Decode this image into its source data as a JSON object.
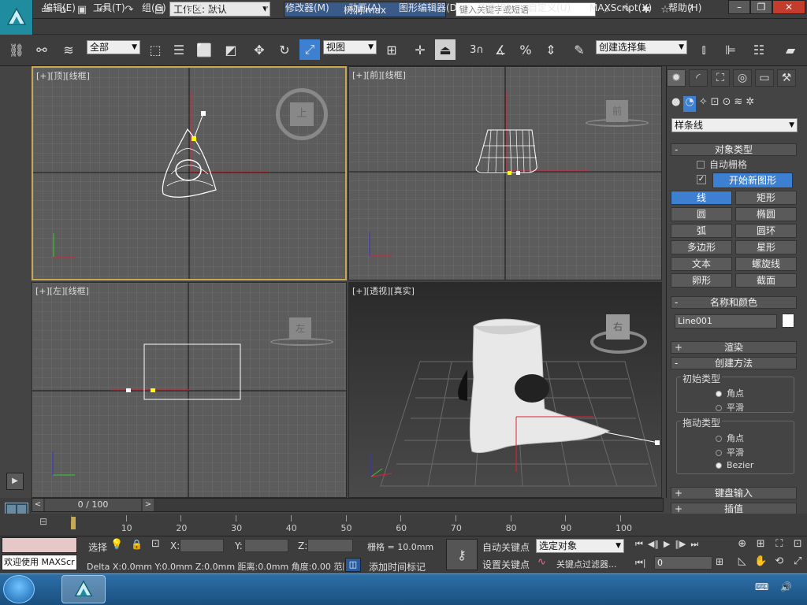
{
  "title_bar": {
    "workspace_label": "工作区: 默认",
    "filename": "树洞.max",
    "search_placeholder": "键入关键字或短语"
  },
  "menu": [
    "编辑(E)",
    "工具(T)",
    "组(G)",
    "视图(V)",
    "创建(C)",
    "修改器(M)",
    "动画(A)",
    "图形编辑器(D)",
    "渲染(R)",
    "自定义(U)",
    "MAXScript(X)",
    "帮助(H)"
  ],
  "toolbar": {
    "selection_filter": "全部",
    "reference_coord": "视图",
    "snap_label": "3",
    "named_selection": "创建选择集"
  },
  "viewports": {
    "top": {
      "label": "[+][顶][线框]",
      "cube_label": "上"
    },
    "front": {
      "label": "[+][前][线框]",
      "cube_label": "前"
    },
    "left": {
      "label": "[+][左][线框]",
      "cube_label": "左"
    },
    "perspective": {
      "label": "[+][透视][真实]",
      "cube_label": "右"
    }
  },
  "command_panel": {
    "category": "样条线",
    "object_type_title": "对象类型",
    "auto_grid": "自动栅格",
    "start_new_shape": "开始新图形",
    "objects": [
      "线",
      "矩形",
      "圆",
      "椭圆",
      "弧",
      "圆环",
      "多边形",
      "星形",
      "文本",
      "螺旋线",
      "卵形",
      "截面"
    ],
    "name_color_title": "名称和颜色",
    "object_name": "Line001",
    "render_title": "渲染",
    "creation_method_title": "创建方法",
    "initial_type_title": "初始类型",
    "initial_options": [
      "角点",
      "平滑"
    ],
    "drag_type_title": "拖动类型",
    "drag_options": [
      "角点",
      "平滑",
      "Bezier"
    ],
    "keyboard_entry_title": "键盘输入",
    "interpolation_title": "插值"
  },
  "timeline": {
    "frame_display": "0 / 100",
    "ticks": [
      "10",
      "20",
      "30",
      "40",
      "50",
      "60",
      "70",
      "80",
      "90",
      "100"
    ]
  },
  "status": {
    "welcome": "欢迎使用 MAXScr",
    "select_label": "选择",
    "x_label": "X:",
    "y_label": "Y:",
    "z_label": "Z:",
    "grid": "栅格 = 10.0mm",
    "delta": "Delta X:0.0mm  Y:0.0mm  Z:0.0mm  距离:0.0mm 角度:0.00 范围:0",
    "add_time_tag": "添加时间标记",
    "auto_key": "自动关键点",
    "set_key": "设置关键点",
    "key_target": "选定对象",
    "key_filters": "关键点过滤器...",
    "current_frame": "0"
  },
  "colors": {
    "active_border": "#c8a850",
    "selected_button": "#3d7fd0",
    "viewport_bg": "#5c5c5c"
  }
}
